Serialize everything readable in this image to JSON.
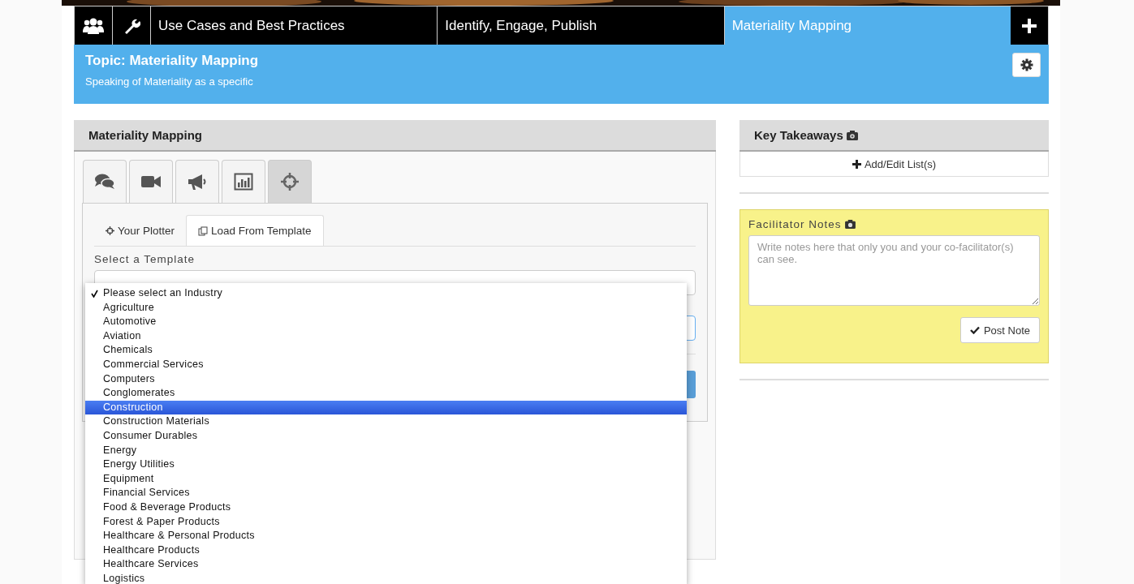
{
  "nav": {
    "tabs": [
      {
        "label": "Use Cases and Best Practices",
        "selected": false
      },
      {
        "label": "Identify, Engage, Publish",
        "selected": false
      },
      {
        "label": "Materiality Mapping",
        "selected": true
      }
    ]
  },
  "topic": {
    "title": "Topic: Materiality Mapping",
    "subtitle": "Speaking of Materiality as a specific"
  },
  "panel": {
    "title": "Materiality Mapping",
    "tool_tabs": [
      {
        "kind": "chat",
        "selected": false
      },
      {
        "kind": "video",
        "selected": false
      },
      {
        "kind": "megaphone",
        "selected": false
      },
      {
        "kind": "chart",
        "selected": false
      },
      {
        "kind": "crosshair",
        "selected": true
      }
    ],
    "sub_tabs": [
      {
        "kind": "plotter",
        "label": "Your Plotter",
        "selected": false
      },
      {
        "kind": "template",
        "label": "Load From Template",
        "selected": true
      }
    ],
    "template_label": "Select a Template",
    "industry_dropdown": {
      "items": [
        {
          "label": "Please select an Industry",
          "checked": true,
          "selected": false
        },
        {
          "label": "Agriculture",
          "checked": false,
          "selected": false
        },
        {
          "label": "Automotive",
          "checked": false,
          "selected": false
        },
        {
          "label": "Aviation",
          "checked": false,
          "selected": false
        },
        {
          "label": "Chemicals",
          "checked": false,
          "selected": false
        },
        {
          "label": "Commercial Services",
          "checked": false,
          "selected": false
        },
        {
          "label": "Computers",
          "checked": false,
          "selected": false
        },
        {
          "label": "Conglomerates",
          "checked": false,
          "selected": false
        },
        {
          "label": "Construction",
          "checked": false,
          "selected": true
        },
        {
          "label": "Construction Materials",
          "checked": false,
          "selected": false
        },
        {
          "label": "Consumer Durables",
          "checked": false,
          "selected": false
        },
        {
          "label": "Energy",
          "checked": false,
          "selected": false
        },
        {
          "label": "Energy Utilities",
          "checked": false,
          "selected": false
        },
        {
          "label": "Equipment",
          "checked": false,
          "selected": false
        },
        {
          "label": "Financial Services",
          "checked": false,
          "selected": false
        },
        {
          "label": "Food & Beverage Products",
          "checked": false,
          "selected": false
        },
        {
          "label": "Forest & Paper Products",
          "checked": false,
          "selected": false
        },
        {
          "label": "Healthcare & Personal Products",
          "checked": false,
          "selected": false
        },
        {
          "label": "Healthcare Products",
          "checked": false,
          "selected": false
        },
        {
          "label": "Healthcare Services",
          "checked": false,
          "selected": false
        },
        {
          "label": "Logistics",
          "checked": false,
          "selected": false
        }
      ]
    }
  },
  "key_takeaways": {
    "title": "Key Takeaways",
    "button": "Add/Edit List(s)"
  },
  "facilitator_notes": {
    "title": "Facilitator Notes",
    "placeholder": "Write notes here that only you and your co-facilitator(s) can see.",
    "button": "Post Note"
  }
}
